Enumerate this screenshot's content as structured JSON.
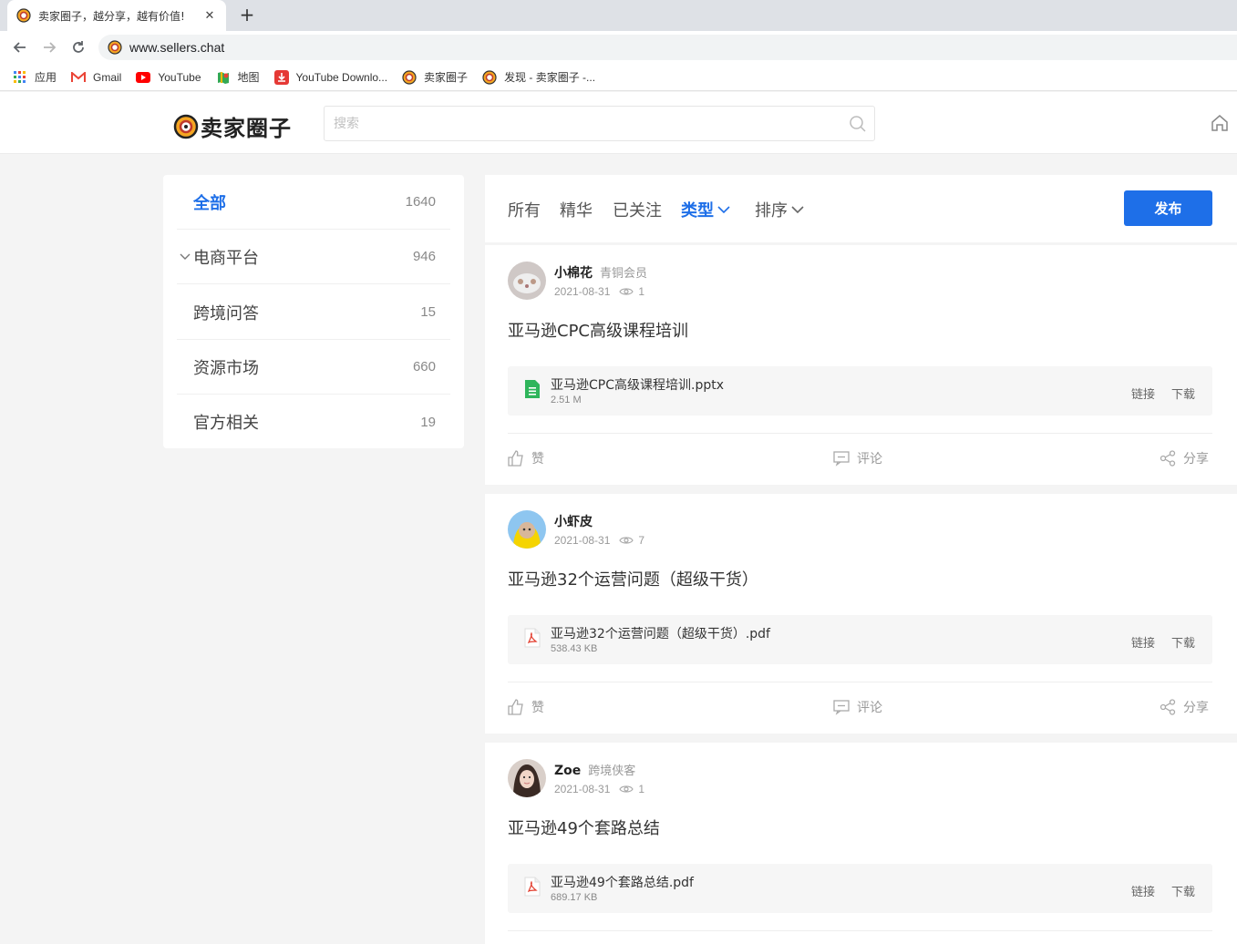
{
  "browser": {
    "tab_title": "卖家圈子，越分享，越有价值!",
    "tab_close": "✕",
    "new_tab": "+",
    "url": "www.sellers.chat",
    "bookmarks": [
      {
        "label": "应用",
        "icon": "apps-grid-icon"
      },
      {
        "label": "Gmail",
        "icon": "gmail-icon"
      },
      {
        "label": "YouTube",
        "icon": "youtube-icon"
      },
      {
        "label": "地图",
        "icon": "maps-icon"
      },
      {
        "label": "YouTube Downlo...",
        "icon": "download-icon"
      },
      {
        "label": "卖家圈子",
        "icon": "sellers-logo-icon"
      },
      {
        "label": "发现 - 卖家圈子 -...",
        "icon": "sellers-logo-icon"
      }
    ]
  },
  "header": {
    "logo_text": "卖家圈子",
    "search_placeholder": "搜索"
  },
  "sidebar": {
    "items": [
      {
        "label": "全部",
        "count": "1640"
      },
      {
        "label": "电商平台",
        "count": "946"
      },
      {
        "label": "跨境问答",
        "count": "15"
      },
      {
        "label": "资源市场",
        "count": "660"
      },
      {
        "label": "官方相关",
        "count": "19"
      }
    ]
  },
  "filters": {
    "tabs": [
      "所有",
      "精华",
      "已关注",
      "类型",
      "排序"
    ],
    "active": "类型",
    "publish": "发布"
  },
  "actions": {
    "like": "赞",
    "comment": "评论",
    "share": "分享",
    "link": "链接",
    "download": "下载"
  },
  "posts": [
    {
      "user": "小棉花",
      "level": "青铜会员",
      "date": "2021-08-31",
      "views": "1",
      "title": "亚马逊CPC高级课程培训",
      "file_name": "亚马逊CPC高级课程培训.pptx",
      "file_size": "2.51 M",
      "file_type": "pptx"
    },
    {
      "user": "小虾皮",
      "level": "",
      "date": "2021-08-31",
      "views": "7",
      "title": "亚马逊32个运营问题（超级干货）",
      "file_name": "亚马逊32个运营问题（超级干货）.pdf",
      "file_size": "538.43 KB",
      "file_type": "pdf"
    },
    {
      "user": "Zoe",
      "level": "跨境侠客",
      "date": "2021-08-31",
      "views": "1",
      "title": "亚马逊49个套路总结",
      "file_name": "亚马逊49个套路总结.pdf",
      "file_size": "689.17 KB",
      "file_type": "pdf"
    }
  ],
  "colors": {
    "accent": "#1e6fe8",
    "page_bg": "#f4f4f4"
  }
}
